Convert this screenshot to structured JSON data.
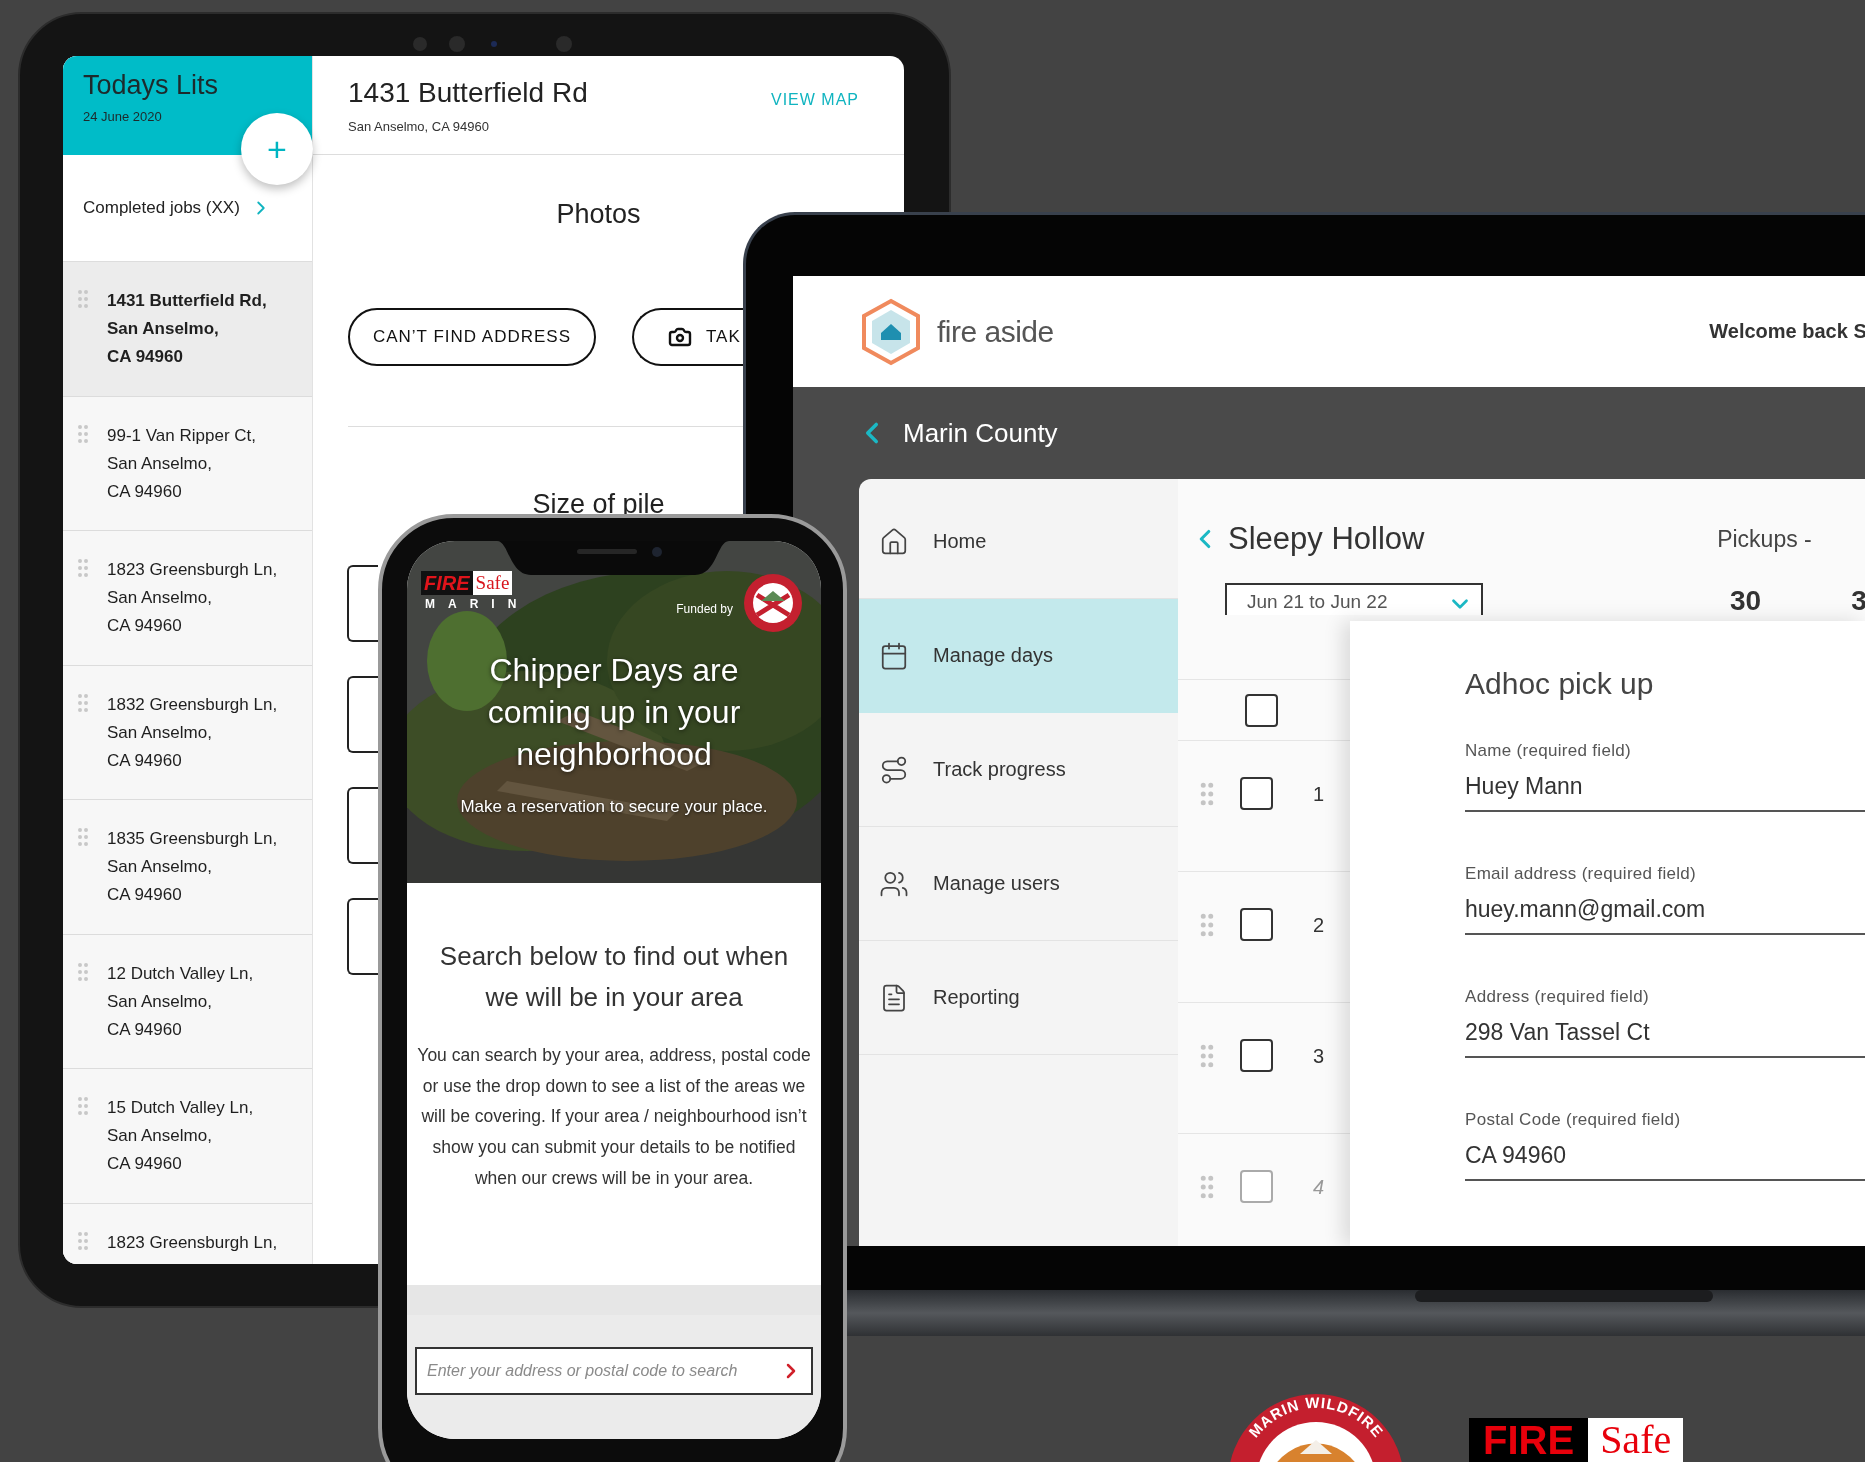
{
  "tablet": {
    "sidebar": {
      "title": "Todays Lits",
      "date": "24 June 2020",
      "add_button": "+",
      "completed_link": "Completed jobs (XX)",
      "jobs": [
        {
          "lines": [
            "1431 Butterfield Rd,",
            "San Anselmo,",
            "CA 94960"
          ],
          "selected": true
        },
        {
          "lines": [
            "99-1 Van Ripper Ct,",
            "San Anselmo,",
            "CA 94960"
          ],
          "selected": false
        },
        {
          "lines": [
            "1823 Greensburgh Ln,",
            "San Anselmo,",
            "CA 94960"
          ],
          "selected": false
        },
        {
          "lines": [
            "1832 Greensburgh Ln,",
            "San Anselmo,",
            "CA 94960"
          ],
          "selected": false
        },
        {
          "lines": [
            "1835 Greensburgh Ln,",
            "San Anselmo,",
            "CA 94960"
          ],
          "selected": false
        },
        {
          "lines": [
            "12 Dutch Valley Ln,",
            "San Anselmo,",
            "CA 94960"
          ],
          "selected": false
        },
        {
          "lines": [
            "15 Dutch Valley Ln,",
            "San Anselmo,",
            "CA 94960"
          ],
          "selected": false
        },
        {
          "lines": [
            "1823 Greensburgh Ln,"
          ],
          "selected": false
        }
      ]
    },
    "job": {
      "address": "1431 Butterfield Rd",
      "city": "San Anselmo, CA 94960",
      "view_map": "VIEW MAP",
      "photos_title": "Photos",
      "buttons": [
        {
          "label": "CAN’T FIND ADDRESS",
          "kind": "text"
        },
        {
          "label": "TAK",
          "kind": "camera"
        }
      ],
      "pile_title": "Size of pile"
    }
  },
  "laptop": {
    "brand": "fire aside",
    "welcome": "Welcome back S",
    "breadcrumb": "Marin County",
    "nav": [
      {
        "label": "Home",
        "kind": "home",
        "selected": false
      },
      {
        "label": "Manage days",
        "kind": "calendar",
        "selected": true
      },
      {
        "label": "Track progress",
        "kind": "route",
        "selected": false
      },
      {
        "label": "Manage users",
        "kind": "users",
        "selected": false
      },
      {
        "label": "Reporting",
        "kind": "report",
        "selected": false
      }
    ],
    "area": "Sleepy Hollow",
    "pickups_label": "Pickups -",
    "date_range": "Jun 21 to Jun 22",
    "counts": [
      "30",
      "3"
    ],
    "select_all_checked": false,
    "rows": [
      {
        "number": "1",
        "checked": false,
        "disabled": false
      },
      {
        "number": "2",
        "checked": false,
        "disabled": false
      },
      {
        "number": "3",
        "checked": false,
        "disabled": false
      },
      {
        "number": "4",
        "checked": false,
        "disabled": true
      }
    ],
    "modal": {
      "title": "Adhoc pick up",
      "fields": [
        {
          "label": "Name (required field)",
          "value": "Huey Mann"
        },
        {
          "label": "Email address (required field)",
          "value": "huey.mann@gmail.com"
        },
        {
          "label": "Address (required field)",
          "value": "298 Van Tassel Ct"
        },
        {
          "label": "Postal Code (required field)",
          "value": "CA 94960"
        }
      ]
    }
  },
  "phone": {
    "logo": {
      "fire": "FIRE",
      "safe": "Safe",
      "marin": "MARIN"
    },
    "funded_by": "Funded by",
    "headline": "Chipper Days are coming up in your neighborhood",
    "subline": "Make a reservation to secure your place.",
    "search_title": "Search below to find out when we will be in your area",
    "body": "You can search by your area, address, postal code or use the drop down to see a list of the areas we will be covering. If your area / neighbourhood isn’t show you can submit your details to be notified when our crews will be in your area.",
    "search": {
      "placeholder": "Enter your address or postal code to search"
    }
  },
  "footer_logos": {
    "seal_text": "MARIN WILDFIRE",
    "fire": "FIRE",
    "safe": "Safe"
  }
}
